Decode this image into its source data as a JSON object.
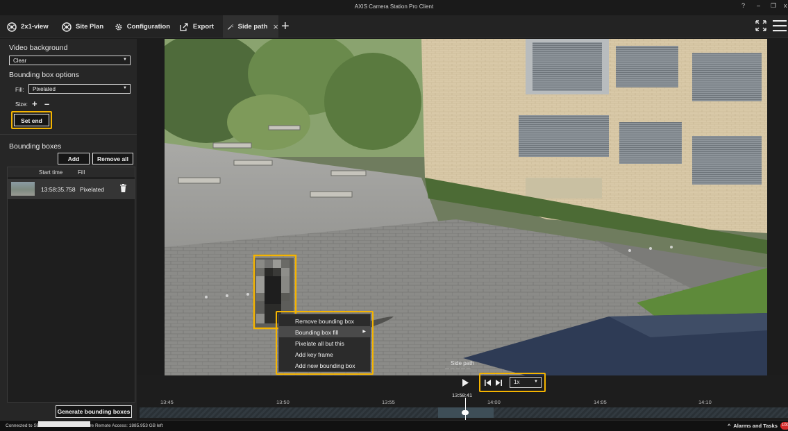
{
  "window": {
    "title": "AXIS Camera Station Pro Client",
    "help_label": "?",
    "minimize_label": "–",
    "restore_label": "❐",
    "close_label": "x"
  },
  "tabs": [
    {
      "label": "2x1-view",
      "icon": "camera-view-icon"
    },
    {
      "label": "Site Plan",
      "icon": "site-plan-icon"
    },
    {
      "label": "Configuration",
      "icon": "gear-icon"
    },
    {
      "label": "Export",
      "icon": "export-icon"
    },
    {
      "label": "Side path",
      "icon": "redact-icon",
      "active": true,
      "close_label": "×"
    }
  ],
  "new_tab_label": "+",
  "left_panel": {
    "video_background": {
      "label": "Video background",
      "value": "Clear"
    },
    "bbox_options": {
      "label": "Bounding box options",
      "fill_label": "Fill:",
      "fill_value": "Pixelated",
      "size_label": "Size:",
      "size_plus": "+",
      "size_minus": "–",
      "set_end_label": "Set end"
    },
    "bounding_boxes": {
      "label": "Bounding boxes",
      "add_label": "Add",
      "remove_all_label": "Remove all",
      "columns": [
        "Start time",
        "Fill"
      ],
      "rows": [
        {
          "start_time": "13:58:35.758",
          "fill": "Pixelated"
        }
      ]
    },
    "generate_label": "Generate bounding boxes"
  },
  "video": {
    "camera_name": "Side path",
    "camera_sub": "— — — — —"
  },
  "context_menu": {
    "items": [
      {
        "label": "Remove bounding box",
        "has_submenu": false
      },
      {
        "label": "Bounding box fill",
        "has_submenu": true,
        "active": true
      },
      {
        "label": "Pixelate all but this",
        "has_submenu": false
      },
      {
        "label": "Add key frame",
        "has_submenu": false
      },
      {
        "label": "Add new bounding box",
        "has_submenu": false
      }
    ]
  },
  "playback": {
    "speed": "1x",
    "current_time": "13:58:41",
    "ticks": [
      "13:45",
      "13:50",
      "13:55",
      "14:00",
      "14:05",
      "14:10"
    ]
  },
  "status": {
    "text": "Connected to SE-LUND-TT-OFFICE  Secure Remote Access: 1885.953 GB left",
    "alarms_label": "Alarms and Tasks",
    "alarms_count": "100"
  },
  "colors": {
    "highlight": "#f5b400",
    "background": "#1b1b1b",
    "panel": "#262626"
  }
}
